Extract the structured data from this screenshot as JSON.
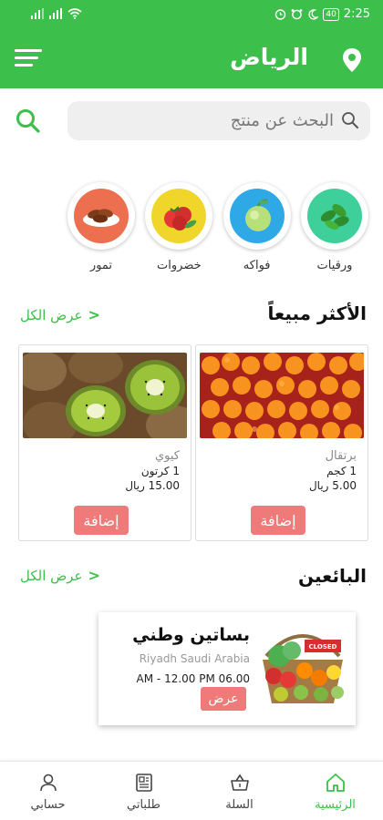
{
  "status_bar": {
    "time": "2:25",
    "battery": "40"
  },
  "header": {
    "city": "الرياض"
  },
  "search": {
    "placeholder": "البحث عن منتج"
  },
  "categories": [
    {
      "label": "ورقيات",
      "icon": "leafy-greens-icon",
      "bg": "#3fcf9a"
    },
    {
      "label": "فواكه",
      "icon": "fruits-icon",
      "bg": "#2fa9e6"
    },
    {
      "label": "خضروات",
      "icon": "vegetables-icon",
      "bg": "#f0d62a"
    },
    {
      "label": "تمور",
      "icon": "dates-icon",
      "bg": "#ec6f4f"
    }
  ],
  "best_sellers": {
    "title": "الأكثر مبيعاً",
    "see_all": "عرض الكل",
    "products": [
      {
        "name": "برتقال",
        "unit": "1 كجم",
        "price": "5.00 ريال",
        "add": "إضافة"
      },
      {
        "name": "كيوي",
        "unit": "1 كرتون",
        "price": "15.00 ريال",
        "add": "إضافة"
      }
    ]
  },
  "vendors": {
    "title": "البائعين",
    "see_all": "عرض الكل",
    "items": [
      {
        "name": "بساتين وطني",
        "location": "Riyadh Saudi Arabia",
        "hours": "AM - 12.00 PM 06.00",
        "button": "عرض",
        "sign": "CLOSED"
      }
    ]
  },
  "bottom_nav": [
    {
      "label": "الرئيسية",
      "icon": "home-icon",
      "active": true
    },
    {
      "label": "السلة",
      "icon": "basket-icon",
      "active": false
    },
    {
      "label": "طلباتي",
      "icon": "orders-icon",
      "active": false
    },
    {
      "label": "حسابي",
      "icon": "account-icon",
      "active": false
    }
  ],
  "colors": {
    "primary": "#3dbf4b",
    "button": "#ee7a7a"
  }
}
